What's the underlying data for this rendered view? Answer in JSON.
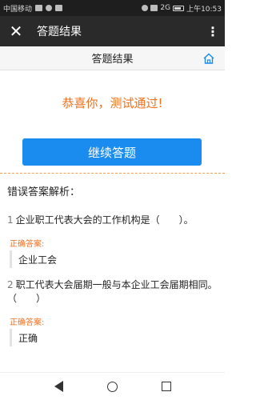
{
  "status_bar": {
    "carrier": "中国移动",
    "right_text": "2G",
    "time": "上午10:53"
  },
  "titlebar": {
    "title": "答题结果"
  },
  "subheader": {
    "title": "答题结果"
  },
  "result": {
    "message": "恭喜你，测试通过!",
    "continue_button": "继续答题"
  },
  "analysis": {
    "section_title": "错误答案解析：",
    "questions": [
      {
        "number": "1",
        "text": "企业职工代表大会的工作机构是（　　）。",
        "answer_label": "正确答案:",
        "answer": "企业工会"
      },
      {
        "number": "2",
        "text": "职工代表大会届期一般与本企业工会届期相同。（　　）",
        "answer_label": "正确答案:",
        "answer": "正确"
      }
    ]
  },
  "colors": {
    "accent_orange": "#f0701e",
    "button_blue": "#1a8cf0",
    "titlebar": "#2a2a2a"
  }
}
